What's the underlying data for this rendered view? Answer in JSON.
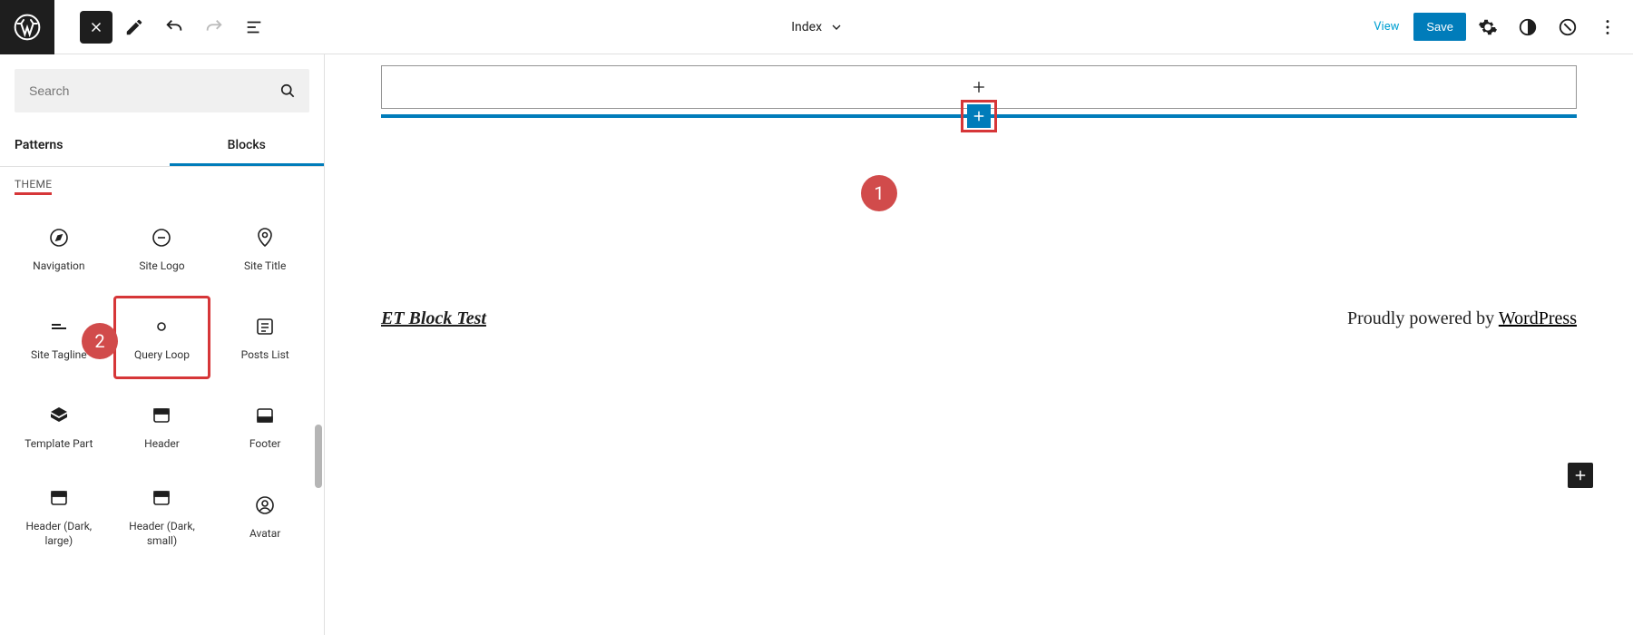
{
  "topbar": {
    "template_name": "Index",
    "view_label": "View",
    "save_label": "Save"
  },
  "sidebar": {
    "search_placeholder": "Search",
    "tabs": {
      "patterns": "Patterns",
      "blocks": "Blocks"
    },
    "section_title": "THEME",
    "blocks": [
      {
        "label": "Navigation",
        "icon": "compass"
      },
      {
        "label": "Site Logo",
        "icon": "circle-minus"
      },
      {
        "label": "Site Title",
        "icon": "map-pin"
      },
      {
        "label": "Site Tagline",
        "icon": "tagline"
      },
      {
        "label": "Query Loop",
        "icon": "loop"
      },
      {
        "label": "Posts List",
        "icon": "posts-list"
      },
      {
        "label": "Template Part",
        "icon": "template-part"
      },
      {
        "label": "Header",
        "icon": "header"
      },
      {
        "label": "Footer",
        "icon": "footer"
      },
      {
        "label": "Header (Dark, large)",
        "icon": "header"
      },
      {
        "label": "Header (Dark, small)",
        "icon": "header"
      },
      {
        "label": "Avatar",
        "icon": "avatar"
      }
    ]
  },
  "canvas": {
    "footer_site_title": "ET Block Test",
    "footer_credit_prefix": "Proudly powered by ",
    "footer_credit_link": "WordPress"
  },
  "annotations": {
    "one": "1",
    "two": "2"
  },
  "colors": {
    "accent": "#007cba",
    "highlight": "#d63638"
  }
}
